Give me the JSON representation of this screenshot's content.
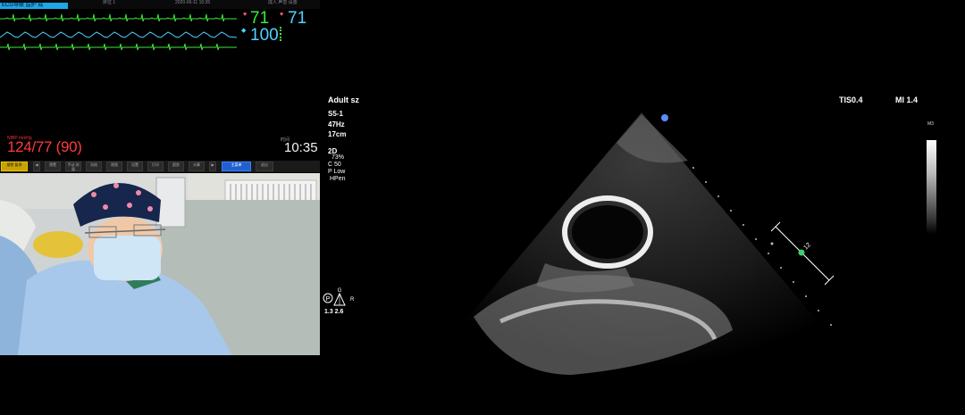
{
  "monitor": {
    "patient_tag": "ECG导联 监护 成",
    "topbar_items": [
      "床位 1",
      "2020-06-11  10:35",
      "成人 声音 设置"
    ],
    "hr": {
      "value": "71",
      "color": "#3dea3d"
    },
    "pulse": {
      "value": "71",
      "color": "#4fd3ff"
    },
    "spo2": {
      "value": "100",
      "color": "#4fd3ff"
    },
    "nibp": {
      "label": "NIBP mmHg",
      "value": "124/77  (90)",
      "color": "#ff3b3b"
    },
    "clock": {
      "label": "时间",
      "value": "10:35"
    },
    "toolbar": {
      "buttons": [
        "报警 暂停",
        "预置",
        "手动 测量",
        "冻结",
        "视图",
        "设置",
        "打印",
        "趋势",
        "计算",
        "主菜单",
        "退出"
      ]
    }
  },
  "ultrasound": {
    "preset": "Adult sz",
    "probe": "S5-1",
    "frame_rate": "47Hz",
    "depth": "17cm",
    "mode": "2D",
    "gain": "73%",
    "compress": "C 50",
    "power": "P Low",
    "harmonic": "HPen",
    "tis": "TIS0.4",
    "mi": "MI 1.4",
    "scale_label": "M3",
    "orientation_letters": {
      "p": "P",
      "g": "G",
      "r": "R"
    },
    "graph_values": "1.3  2.6",
    "depth_marker": "12"
  }
}
